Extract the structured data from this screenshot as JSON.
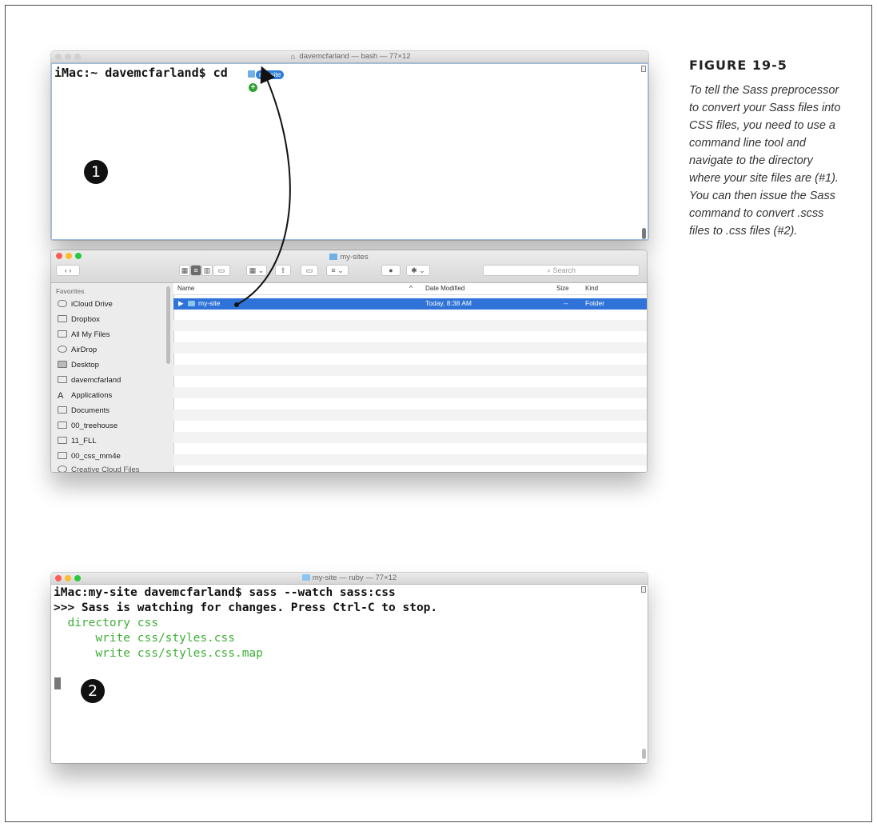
{
  "figure": {
    "label": "FIGURE 19-5",
    "caption": "To tell the Sass preprocessor to convert your Sass files into CSS files, you need to use a command line tool and navigate to the directory where your site files are (#1). You can then issue the Sass command to convert .scss files to .css files (#2)."
  },
  "terminal1": {
    "title": "davemcfarland — bash — 77×12",
    "line": "iMac:~ davemcfarland$ cd",
    "drag_label": "my-site",
    "badge": "1"
  },
  "finder": {
    "title": "my-sites",
    "search_placeholder": "Search",
    "sidebar_heading": "Favorites",
    "sidebar_items": [
      "iCloud Drive",
      "Dropbox",
      "All My Files",
      "AirDrop",
      "Desktop",
      "davemcfarland",
      "Applications",
      "Documents",
      "00_treehouse",
      "11_FLL",
      "00_css_mm4e",
      "Creative Cloud Files"
    ],
    "columns": {
      "name": "Name",
      "date": "Date Modified",
      "size": "Size",
      "kind": "Kind"
    },
    "row": {
      "name": "my-site",
      "date": "Today, 8:38 AM",
      "size": "--",
      "kind": "Folder"
    }
  },
  "terminal2": {
    "title": "my-site — ruby — 77×12",
    "lines": [
      "iMac:my-site davemcfarland$ sass --watch sass:css",
      ">>> Sass is watching for changes. Press Ctrl-C to stop.",
      "  directory css",
      "      write css/styles.css",
      "      write css/styles.css.map"
    ],
    "badge": "2"
  },
  "colors": {
    "selection": "#2f73d9",
    "terminal_green": "#3fae37",
    "traffic_red": "#fc5f57",
    "traffic_yellow": "#fdbc2e",
    "traffic_green": "#28c840"
  }
}
